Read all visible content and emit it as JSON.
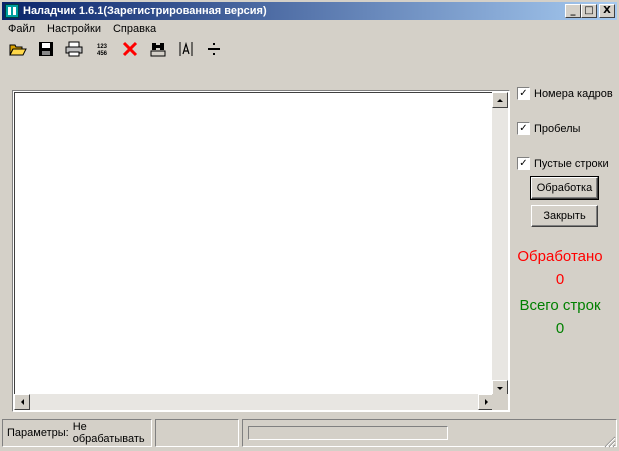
{
  "window": {
    "title": "Наладчик 1.6.1(Зарегистрированная версия)",
    "minimize": "_",
    "maximize": "□",
    "close": "X"
  },
  "menu": {
    "items": [
      "Файл",
      "Настройки",
      "Справка"
    ]
  },
  "toolbar": {
    "icons": [
      "open-folder-icon",
      "save-icon",
      "print-icon",
      "numbering-icon",
      "delete-icon",
      "find-icon",
      "text-format-icon",
      "divide-icon"
    ],
    "numbering_text_top": "123",
    "numbering_text_bottom": "456"
  },
  "options": {
    "frame_numbers": {
      "label": "Номера кадров",
      "checked": true
    },
    "spaces": {
      "label": "Пробелы",
      "checked": true
    },
    "empty_lines": {
      "label": "Пустые строки",
      "checked": true
    },
    "check_mark": "✓"
  },
  "buttons": {
    "process": "Обработка",
    "close": "Закрыть"
  },
  "stats": {
    "processed_label": "Обработано",
    "processed_value": "0",
    "total_label": "Всего строк",
    "total_value": "0"
  },
  "status": {
    "params_label": "Параметры:",
    "params_value": "Не обрабатывать",
    "progress_fraction": 0
  },
  "colors": {
    "processed": "#ff0000",
    "total": "#008000"
  }
}
